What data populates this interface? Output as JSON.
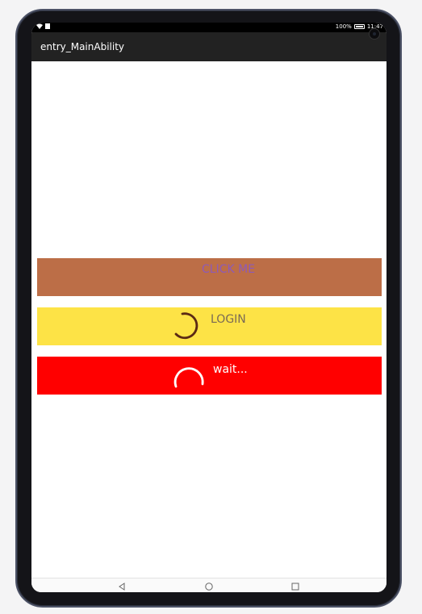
{
  "status_bar": {
    "battery": "100%",
    "time": "11:47"
  },
  "app": {
    "title": "entry_MainAbility"
  },
  "buttons": {
    "click_label": "CLICK ME",
    "login_label": "LOGIN",
    "wait_label": "wait..."
  },
  "icons": {
    "wifi": "wifi-icon",
    "sim": "sim-icon",
    "battery": "battery-icon",
    "login_spinner": "loading-spinner-icon",
    "wait_spinner": "loading-spinner-icon",
    "back": "back-triangle-icon",
    "home": "home-circle-icon",
    "recent": "recent-square-icon"
  },
  "colors": {
    "click_bg": "#bc6e47",
    "click_text": "#8d5ab8",
    "login_bg": "#fde346",
    "wait_bg": "#ff0000",
    "titlebar_bg": "#222222"
  }
}
